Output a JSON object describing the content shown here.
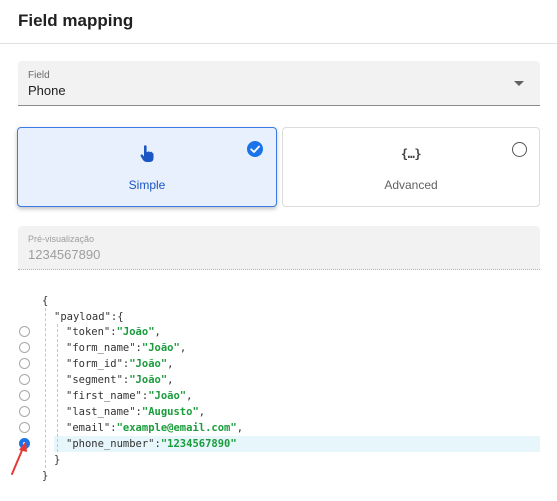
{
  "header": {
    "title": "Field mapping"
  },
  "field_select": {
    "label": "Field",
    "value": "Phone"
  },
  "mode_options": [
    {
      "label": "Simple",
      "icon": "hand-pointer-icon",
      "selected": true
    },
    {
      "label": "Advanced",
      "icon": "curly-braces-icon",
      "icon_text": "{…}",
      "selected": false
    }
  ],
  "preview": {
    "label": "Pré-visualização",
    "value": "1234567890"
  },
  "json_tree": {
    "open_brace": "{",
    "payload_key": "\"payload\"",
    "payload_open": ":{",
    "close_inner": "}",
    "close_outer": "}",
    "rows": [
      {
        "key": "\"token\"",
        "value": "\"João\"",
        "sep": ",",
        "selected": false
      },
      {
        "key": "\"form_name\"",
        "value": "\"João\"",
        "sep": ",",
        "selected": false
      },
      {
        "key": "\"form_id\"",
        "value": "\"João\"",
        "sep": ",",
        "selected": false
      },
      {
        "key": "\"segment\"",
        "value": "\"João\"",
        "sep": ",",
        "selected": false
      },
      {
        "key": "\"first_name\"",
        "value": "\"João\"",
        "sep": ",",
        "selected": false
      },
      {
        "key": "\"last_name\"",
        "value": "\"Augusto\"",
        "sep": ",",
        "selected": false
      },
      {
        "key": "\"email\"",
        "value": "\"example@email.com\"",
        "sep": ",",
        "selected": false
      },
      {
        "key": "\"phone_number\"",
        "value": "\"1234567890\"",
        "sep": "",
        "selected": true
      }
    ]
  },
  "colors": {
    "accent": "#1a73e8",
    "selected_card_bg": "#e8f0fd",
    "json_value": "#1a9c3c",
    "row_highlight": "#e7f6fb",
    "annotation_arrow": "#e53935"
  }
}
